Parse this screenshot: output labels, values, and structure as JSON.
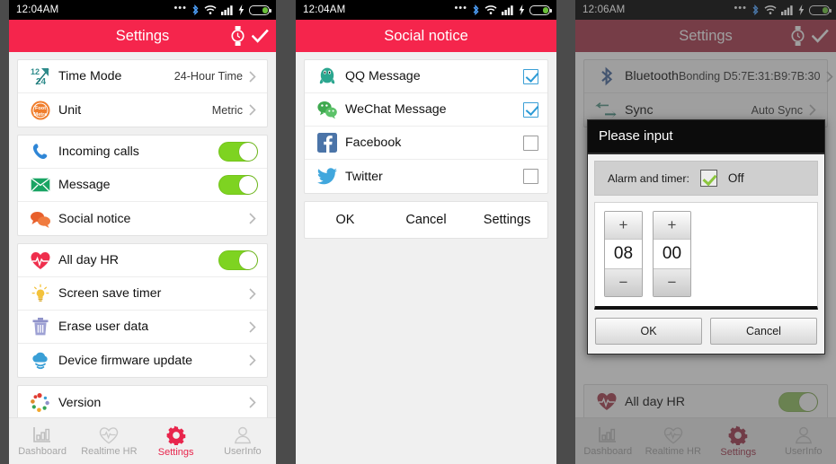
{
  "panels": {
    "left": {
      "statusbar": {
        "time": "12:04AM",
        "icons": [
          "more-dots",
          "bluetooth",
          "wifi",
          "signal",
          "charging",
          "battery"
        ]
      },
      "appbar": {
        "title": "Settings",
        "actions": [
          "watch-icon",
          "check-icon"
        ]
      },
      "groups": [
        {
          "rows": [
            {
              "icon": "time-mode-icon",
              "label": "Time Mode",
              "value": "24-Hour Time",
              "control": "chevron"
            },
            {
              "icon": "unit-icon",
              "label": "Unit",
              "value": "Metric",
              "control": "chevron"
            }
          ]
        },
        {
          "rows": [
            {
              "icon": "phone-icon",
              "label": "Incoming calls",
              "value": "",
              "control": "toggle-on"
            },
            {
              "icon": "envelope-icon",
              "label": "Message",
              "value": "",
              "control": "toggle-on"
            },
            {
              "icon": "chat-bubbles-icon",
              "label": "Social notice",
              "value": "",
              "control": "chevron"
            }
          ]
        },
        {
          "rows": [
            {
              "icon": "heartbeat-icon",
              "label": "All day HR",
              "value": "",
              "control": "toggle-on"
            },
            {
              "icon": "lightbulb-icon",
              "label": "Screen save timer",
              "value": "",
              "control": "chevron"
            },
            {
              "icon": "trash-icon",
              "label": "Erase user data",
              "value": "",
              "control": "chevron"
            },
            {
              "icon": "cloud-download-icon",
              "label": "Device firmware update",
              "value": "",
              "control": "chevron"
            }
          ]
        },
        {
          "rows": [
            {
              "icon": "version-dots-icon",
              "label": "Version",
              "value": "",
              "control": "chevron"
            }
          ]
        }
      ],
      "tabs": [
        {
          "icon": "bar-chart-icon",
          "label": "Dashboard",
          "active": false
        },
        {
          "icon": "heart-pulse-icon",
          "label": "Realtime HR",
          "active": false
        },
        {
          "icon": "gear-icon",
          "label": "Settings",
          "active": true
        },
        {
          "icon": "person-icon",
          "label": "UserInfo",
          "active": false
        }
      ]
    },
    "middle": {
      "statusbar": {
        "time": "12:04AM"
      },
      "appbar": {
        "title": "Social notice"
      },
      "items": [
        {
          "icon": "qq-penguin-icon",
          "label": "QQ Message",
          "checked": true
        },
        {
          "icon": "wechat-icon",
          "label": "WeChat Message",
          "checked": true
        },
        {
          "icon": "facebook-icon",
          "label": "Facebook",
          "checked": false
        },
        {
          "icon": "twitter-icon",
          "label": "Twitter",
          "checked": false
        }
      ],
      "buttons": [
        {
          "label": "OK",
          "name": "ok-button"
        },
        {
          "label": "Cancel",
          "name": "cancel-button"
        },
        {
          "label": "Settings",
          "name": "settings-button"
        }
      ]
    },
    "right": {
      "statusbar": {
        "time": "12:06AM"
      },
      "appbar": {
        "title": "Settings",
        "actions": [
          "watch-icon",
          "check-icon"
        ]
      },
      "rows_top": [
        {
          "icon": "bluetooth-icon",
          "label": "Bluetooth",
          "value": "Bonding D5:7E:31:B9:7B:30",
          "control": "chevron"
        },
        {
          "icon": "sync-arrows-icon",
          "label": "Sync",
          "value": "Auto Sync",
          "control": "chevron"
        }
      ],
      "rows_bottom": [
        {
          "icon": "heartbeat-icon",
          "label": "All day HR",
          "value": "",
          "control": "toggle-on"
        }
      ],
      "dialog": {
        "title": "Please input",
        "alarm_label": "Alarm and timer:",
        "alarm_state": "Off",
        "alarm_checked": true,
        "spinners": [
          {
            "plus": "+",
            "value": "08",
            "minus": "−",
            "name": "hour-spinner"
          },
          {
            "plus": "+",
            "value": "00",
            "minus": "−",
            "name": "minute-spinner"
          }
        ],
        "ok_label": "OK",
        "cancel_label": "Cancel"
      },
      "tabs": [
        {
          "label": "Dashboard",
          "active": false
        },
        {
          "label": "Realtime HR",
          "active": false
        },
        {
          "label": "Settings",
          "active": true
        },
        {
          "label": "UserInfo",
          "active": false
        }
      ]
    }
  },
  "colors": {
    "appbar_red": "#f5254c",
    "accent_red": "#e8254c",
    "toggle_green": "#7ed321",
    "checkbox_blue": "#2d9bd6",
    "gutter": "#4b4b4b",
    "page_bg": "#f0f0f0"
  }
}
